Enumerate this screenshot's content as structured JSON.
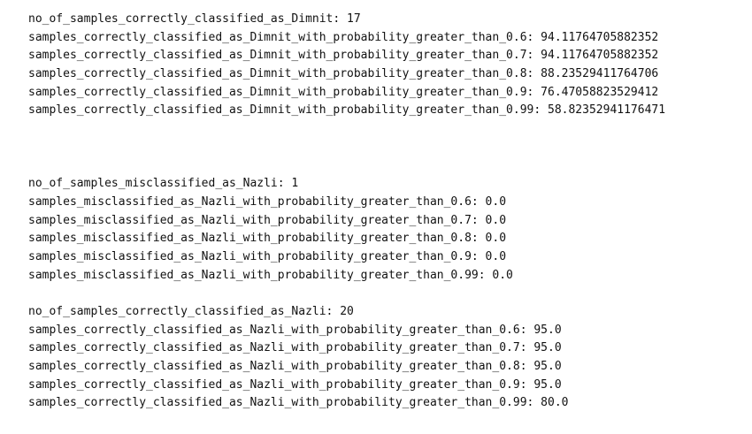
{
  "output_blocks": [
    {
      "lines": [
        "no_of_samples_correctly_classified_as_Dimnit: 17",
        "samples_correctly_classified_as_Dimnit_with_probability_greater_than_0.6: 94.11764705882352",
        "samples_correctly_classified_as_Dimnit_with_probability_greater_than_0.7: 94.11764705882352",
        "samples_correctly_classified_as_Dimnit_with_probability_greater_than_0.8: 88.23529411764706",
        "samples_correctly_classified_as_Dimnit_with_probability_greater_than_0.9: 76.47058823529412",
        "samples_correctly_classified_as_Dimnit_with_probability_greater_than_0.99: 58.82352941176471"
      ]
    },
    {
      "lines": [
        "no_of_samples_misclassified_as_Nazli: 1",
        "samples_misclassified_as_Nazli_with_probability_greater_than_0.6: 0.0",
        "samples_misclassified_as_Nazli_with_probability_greater_than_0.7: 0.0",
        "samples_misclassified_as_Nazli_with_probability_greater_than_0.8: 0.0",
        "samples_misclassified_as_Nazli_with_probability_greater_than_0.9: 0.0",
        "samples_misclassified_as_Nazli_with_probability_greater_than_0.99: 0.0"
      ]
    },
    {
      "lines": [
        "no_of_samples_correctly_classified_as_Nazli: 20",
        "samples_correctly_classified_as_Nazli_with_probability_greater_than_0.6: 95.0",
        "samples_correctly_classified_as_Nazli_with_probability_greater_than_0.7: 95.0",
        "samples_correctly_classified_as_Nazli_with_probability_greater_than_0.8: 95.0",
        "samples_correctly_classified_as_Nazli_with_probability_greater_than_0.9: 95.0",
        "samples_correctly_classified_as_Nazli_with_probability_greater_than_0.99: 80.0"
      ]
    }
  ]
}
